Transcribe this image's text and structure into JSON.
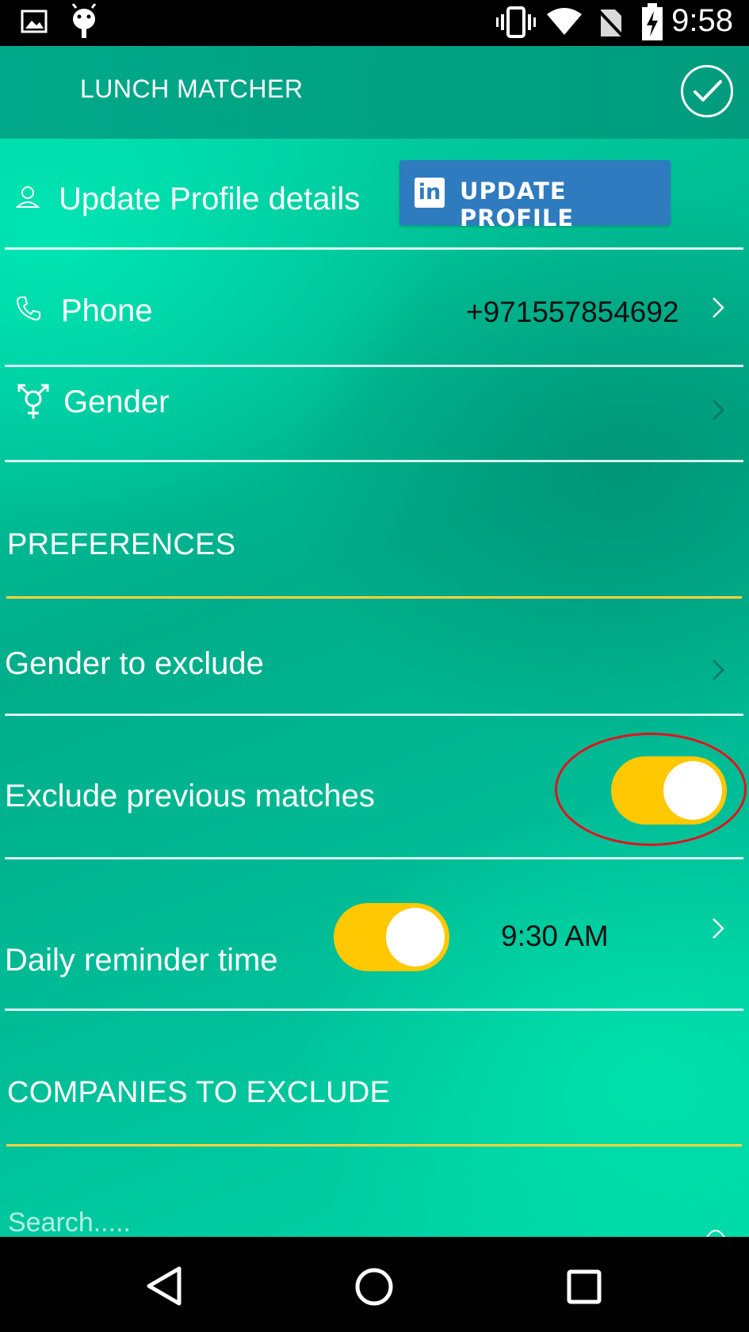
{
  "status_bar": {
    "time": "9:58",
    "icons": [
      "image-icon",
      "android-debug-icon",
      "vibrate-icon",
      "wifi-icon",
      "no-sim-icon",
      "battery-charging-icon"
    ]
  },
  "app_bar": {
    "title": "LUNCH MATCHER",
    "confirm_icon": "check-icon"
  },
  "profile": {
    "label": "Update Profile details",
    "icon": "person-icon",
    "linkedin_button_label": "UPDATE PROFILE",
    "linkedin_logo_text": "in"
  },
  "phone": {
    "label": "Phone",
    "value": "+971557854692",
    "icon": "phone-icon"
  },
  "gender": {
    "label": "Gender",
    "icon": "gender-icon"
  },
  "preferences": {
    "header": "PREFERENCES",
    "gender_to_exclude_label": "Gender to exclude",
    "exclude_previous_label": "Exclude previous matches",
    "exclude_previous_on": true,
    "daily_reminder_label": "Daily reminder time",
    "daily_reminder_on": true,
    "daily_reminder_value": "9:30 AM"
  },
  "companies": {
    "header": "COMPANIES TO EXCLUDE",
    "search_placeholder": "Search....."
  },
  "colors": {
    "accent_yellow": "#ffc800",
    "app_bar": "#00a989",
    "linkedin_blue": "#2f7bbf",
    "highlight_red": "#e0141c"
  },
  "nav_bar": {
    "icons": [
      "back-icon",
      "home-icon",
      "recents-icon"
    ]
  }
}
